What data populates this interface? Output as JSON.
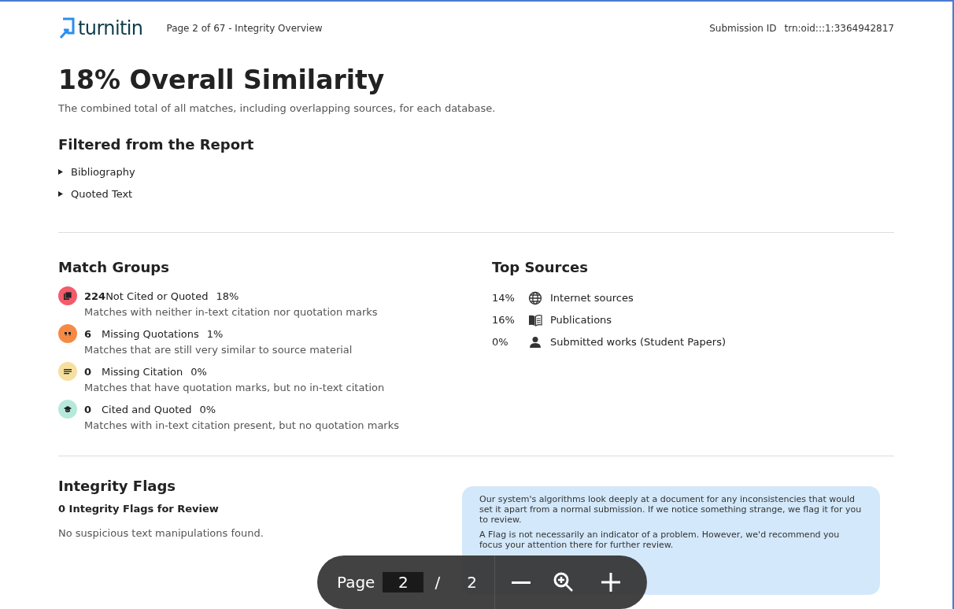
{
  "header": {
    "logo": "turnitin",
    "page_info": "Page 2 of 67 - Integrity Overview",
    "submission_label": "Submission ID",
    "submission_id": "trn:oid:::1:3364942817"
  },
  "title": "18% Overall Similarity",
  "subtitle": "The combined total of all matches, including overlapping sources, for each database.",
  "filtered": {
    "heading": "Filtered from the Report",
    "items": [
      {
        "label": "Bibliography",
        "expanded": false
      },
      {
        "label": "Quoted Text",
        "expanded": false
      }
    ]
  },
  "match_groups": {
    "heading": "Match Groups",
    "items": [
      {
        "kind": "not-cited",
        "color": "#f25c6b",
        "count": "224",
        "label": "Not Cited or Quoted",
        "percent": "18%",
        "description": "Matches with neither in-text citation nor quotation marks"
      },
      {
        "kind": "missing-quotations",
        "color": "#f58a45",
        "count": "6",
        "label": "Missing Quotations",
        "percent": "1%",
        "description": "Matches that are still very similar to source material"
      },
      {
        "kind": "missing-citation",
        "color": "#f5e0a0",
        "count": "0",
        "label": "Missing Citation",
        "percent": "0%",
        "description": "Matches that have quotation marks, but no in-text citation"
      },
      {
        "kind": "cited",
        "color": "#b7e8dc",
        "count": "0",
        "label": "Cited and Quoted",
        "percent": "0%",
        "description": "Matches with in-text citation present, but no quotation marks"
      }
    ]
  },
  "top_sources": {
    "heading": "Top Sources",
    "items": [
      {
        "kind": "internet",
        "percent": "14%",
        "label": "Internet sources"
      },
      {
        "kind": "publications",
        "percent": "16%",
        "label": "Publications"
      },
      {
        "kind": "submitted",
        "percent": "0%",
        "label": "Submitted works (Student Papers)"
      }
    ]
  },
  "integrity_flags": {
    "heading": "Integrity Flags",
    "count_label": "0 Integrity Flags for Review",
    "message": "No suspicious text manipulations found."
  },
  "info_box": [
    "Our system's algorithms look deeply at a document for any inconsistencies that would set it apart from a normal submission. If we notice something strange, we flag it for you to review.",
    "A Flag is not necessarily an indicator of a problem. However, we'd recommend you focus your attention there for further review."
  ],
  "toolbar": {
    "page_label": "Page",
    "page_value": "2",
    "separator": "/",
    "total": "2"
  }
}
